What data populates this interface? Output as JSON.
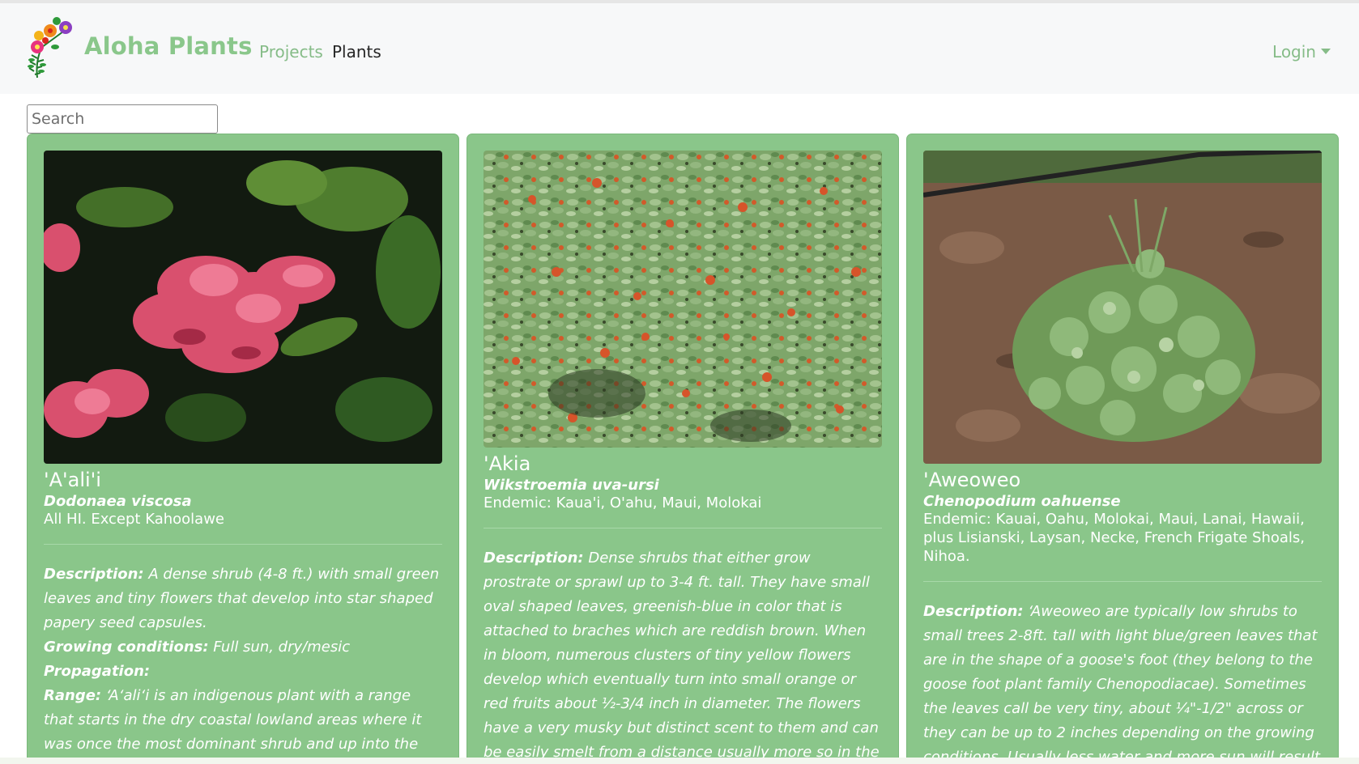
{
  "app": {
    "brand": "Aloha Plants",
    "accent_color": "#8ac78b",
    "card_color": "#8ac68a"
  },
  "nav": {
    "links": [
      {
        "label": "Projects",
        "active": false
      },
      {
        "label": "Plants",
        "active": true
      }
    ],
    "login_label": "Login",
    "login_icon": "caret-down-icon",
    "logo_icon": "hibiscus-flowers-logo"
  },
  "search": {
    "placeholder": "Search",
    "value": ""
  },
  "plants": [
    {
      "common_name": "'A'ali'i",
      "scientific_name": "Dodonaea viscosa",
      "range_summary": "All HI. Except Kahoolawe",
      "description_label": "Description:",
      "description": " A dense shrub (4-8 ft.) with small green leaves and tiny flowers that develop into star shaped papery seed capsules.",
      "growing_label": "Growing conditions:",
      "growing": " Full sun, dry/mesic",
      "propagation_label": "Propagation:",
      "propagation": "",
      "range_label": "Range:",
      "range": " ʻAʻaliʻi is an indigenous plant with a range that starts in the dry coastal lowland areas where it was once the most dominant shrub and up into the wetter mesic"
    },
    {
      "common_name": "'Akia",
      "scientific_name": "Wikstroemia uva-ursi",
      "range_summary": "Endemic: Kaua'i, O'ahu, Maui, Molokai",
      "description_label": "Description:",
      "description": " Dense shrubs that either grow prostrate or sprawl up to 3-4 ft. tall. They have small oval shaped leaves, greenish-blue in color that is attached to braches which are reddish brown. When in bloom, numerous clusters of tiny yellow flowers develop which eventually turn into small orange or red fruits about ½-3/4 inch in diameter. The flowers have a very musky but distinct scent to them and can be easily smelt from a distance usually more so in the early evening."
    },
    {
      "common_name": "'Aweoweo",
      "scientific_name": "Chenopodium oahuense",
      "range_summary": "Endemic: Kauai, Oahu, Molokai, Maui, Lanai, Hawaii, plus Lisianski, Laysan, Necke, French Frigate Shoals, Nihoa.",
      "description_label": "Description:",
      "description": " ʻAweoweo are typically low shrubs to small trees 2-8ft. tall with light blue/green leaves that are in the shape of a goose's foot (they belong to the goose foot plant family Chenopodiacae). Sometimes the leaves call be very tiny, about ¼\"-1/2\" across or they can be up to 2 inches depending on the growing conditions. Usually less water and more sun will result in smaller, thicker leaves."
    }
  ]
}
